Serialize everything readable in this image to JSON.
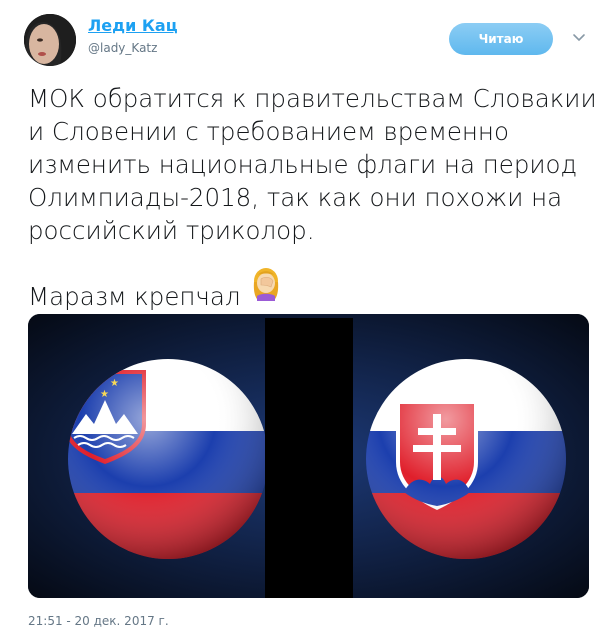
{
  "author": {
    "display_name": "Леди Кац",
    "handle": "@lady_Katz"
  },
  "follow_button": {
    "label": "Читаю"
  },
  "tweet": {
    "text": "МОК обратится к правительствам Словакии\nи Словении с требованием временно\nизменить национальные флаги на период\nОлимпиады-2018, так как они похожи на\nроссийский триколор.\n\nМаразм крепчал",
    "emoji": "facepalm-emoji"
  },
  "timestamp": "21:51 - 20 дек. 2017 г.",
  "colors": {
    "link": "#1da1f2",
    "muted": "#657786",
    "follow_button": "#6ebef0",
    "flag_white": "#ffffff",
    "flag_blue": "#1c3fae",
    "flag_red": "#e01f2b"
  }
}
